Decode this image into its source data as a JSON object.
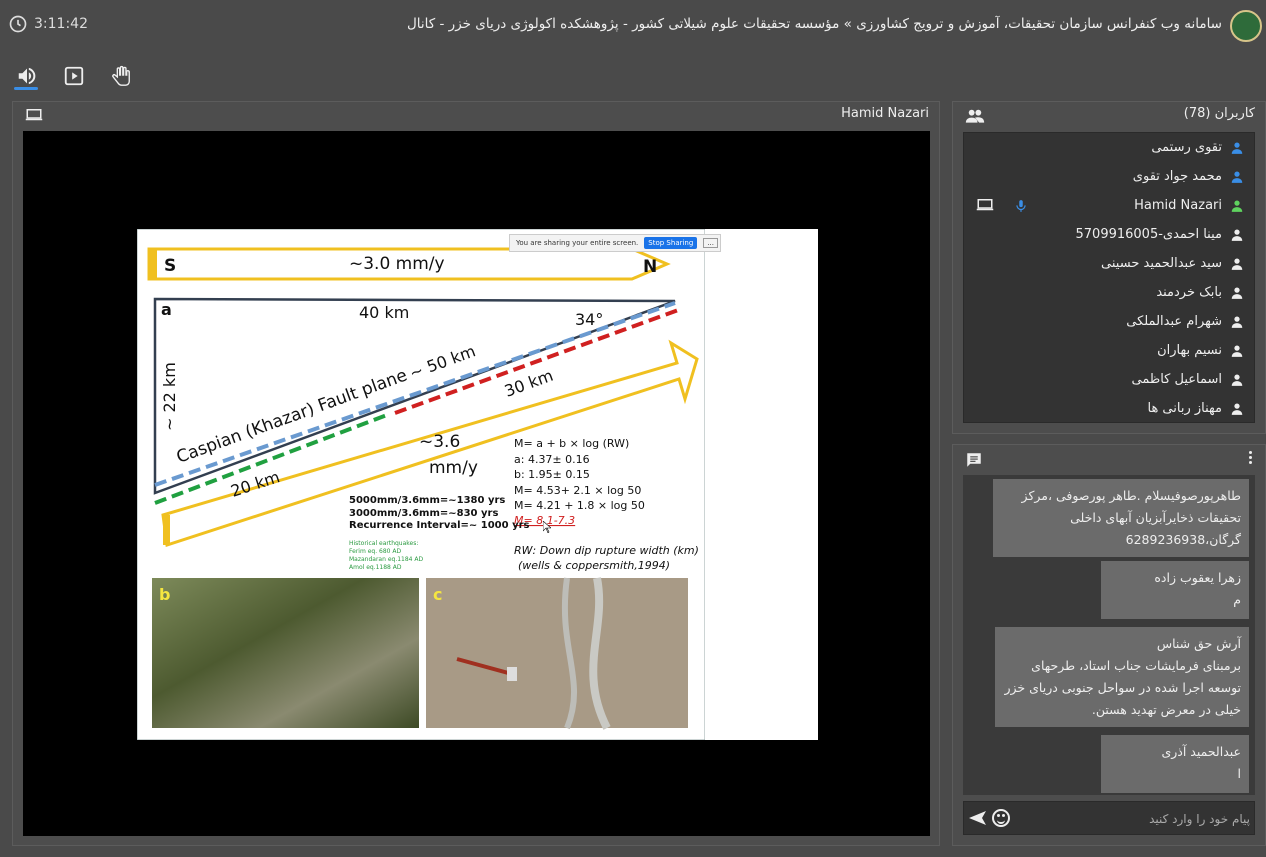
{
  "header": {
    "timer": "3:11:42",
    "title": "سامانه وب کنفرانس سازمان تحقیقات، آموزش و ترویج کشاورزی » مؤسسه تحقیقات علوم شیلاتی کشور - پژوهشکده اکولوژی دریای خزر - کانال"
  },
  "toolbar": {
    "audio": "speaker-icon",
    "present": "play-screen-icon",
    "raise_hand": "hand-icon",
    "menu": "hamburger-icon"
  },
  "presentation": {
    "presenter": "Hamid Nazari",
    "share_bar": {
      "message": "You are sharing your entire screen.",
      "stop_label": "Stop Sharing",
      "more_label": "..."
    },
    "slide": {
      "south": "S",
      "north": "N",
      "rate_top": "~3.0 mm/y",
      "label_a": "a",
      "label_b": "b",
      "label_c": "c",
      "len_40": "40 km",
      "angle": "34°",
      "depth": "~ 22 km",
      "fault_plane": "Caspian (Khazar) Fault plane",
      "len_50": "~ 50 km",
      "len_30": "30 km",
      "len_20": "20 km",
      "rate_bottom_1": "~3.6",
      "rate_bottom_2": "mm/y",
      "eq_1": "M= a + b × log (RW)",
      "eq_2": "a: 4.37± 0.16",
      "eq_3": "b: 1.95± 0.15",
      "eq_4": "M= 4.53+ 2.1 × log 50",
      "eq_5": "M= 4.21 + 1.8 × log 50",
      "eq_6": "M= 8.1-7.3",
      "rec_1": "5000mm/3.6mm=~1380 yrs",
      "rec_2": "3000mm/3.6mm=~830 yrs",
      "rec_3": "Recurrence Interval=~ 1000 yrs",
      "hist_title": "Historical earthquakes:",
      "hist_1": "Ferim eq. 680 AD",
      "hist_2": "Mazandaran eq.1184 AD",
      "hist_3": "Amol eq.1188 AD",
      "rw_1": "RW: Down dip rupture width (km)",
      "rw_2": "(wells & coppersmith,1994)"
    }
  },
  "users": {
    "title": "کاربران (78)",
    "list": [
      {
        "name": "تقوی رستمی",
        "color": "#3a8ee6"
      },
      {
        "name": "محمد جواد تقوی",
        "color": "#3a8ee6"
      },
      {
        "name": "Hamid Nazari",
        "color": "#5fd35f",
        "mic": true,
        "screen": true
      },
      {
        "name": "مینا احمدی-5709916005",
        "color": "#eeeeee"
      },
      {
        "name": "سید عبدالحمید حسینی",
        "color": "#eeeeee"
      },
      {
        "name": "بابک خردمند",
        "color": "#eeeeee"
      },
      {
        "name": "شهرام عبدالملکی",
        "color": "#eeeeee"
      },
      {
        "name": "نسیم بهاران",
        "color": "#eeeeee"
      },
      {
        "name": "اسماعیل کاظمی",
        "color": "#eeeeee"
      },
      {
        "name": "مهناز ربانی ها",
        "color": "#eeeeee"
      }
    ]
  },
  "chat": {
    "messages": [
      {
        "author": "",
        "text": "طاهرپورصوفیسلام .طاهر پورصوفی ،مرکز تحقیقات ذخایرآبزیان آبهای داخلی گرگان،6289236938"
      },
      {
        "author": "زهرا یعقوب زاده",
        "text": "م"
      },
      {
        "author": "آرش حق شناس",
        "text": "برمبنای فرمایشات جناب استاد، طرحهای توسعه اجرا شده در سواحل جنوبی دریای خزر خیلی در معرض تهدید هستن."
      },
      {
        "author": "عبدالحمید آذری",
        "text": "ا"
      }
    ],
    "placeholder": "پیام خود را وارد کنید"
  },
  "colors": {
    "background": "#4a4a4a",
    "panel": "#4d4d4d",
    "accent": "#3a8ee6",
    "presenter_green": "#5fd35f"
  }
}
